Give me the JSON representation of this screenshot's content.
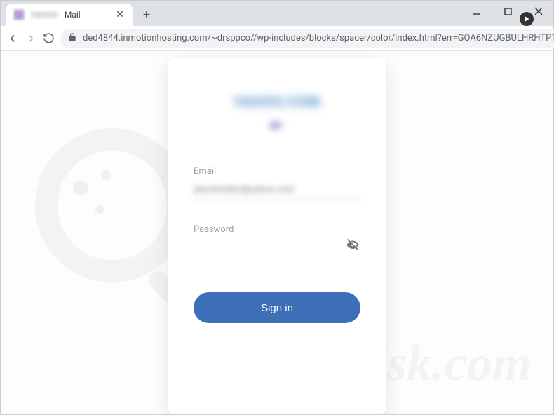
{
  "window": {
    "tab_title_suffix": " - Mail",
    "minimize": "–",
    "maximize": "☐",
    "close": "✕",
    "newtab": "+"
  },
  "addressbar": {
    "url_display": "ded4844.inmotionhosting.com/~drsppco//wp-includes/blocks/spacer/color/index.html?err=GOA6NZUGBULHRHTPT…"
  },
  "page": {
    "brand_line1": "YAHOO.COM",
    "brand_line2": "ah-",
    "email_label": "Email",
    "email_value": "placeholder@yahoo.com",
    "password_label": "Password",
    "password_value": "",
    "signin_label": "Sign in"
  },
  "watermark": {
    "text": "risk.com"
  }
}
